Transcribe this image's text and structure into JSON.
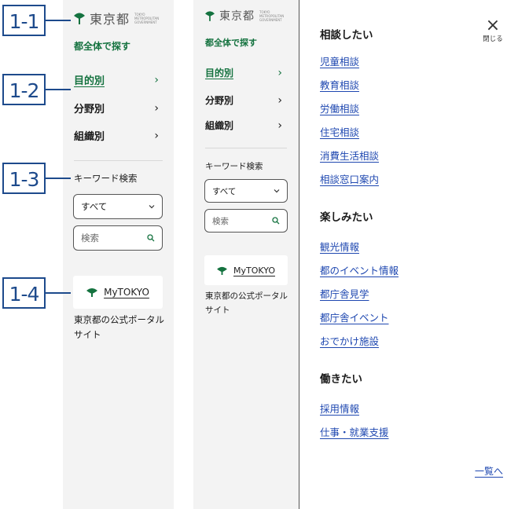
{
  "brand": {
    "name": "東京都",
    "sub": "TOKYO METROPOLITAN GOVERNMENT",
    "color": "#14723f"
  },
  "callouts": [
    "1-1",
    "1-2",
    "1-3",
    "1-4"
  ],
  "sidebar": {
    "section_label": "都全体で探す",
    "nav": [
      {
        "label": "目的別",
        "active": true
      },
      {
        "label": "分野別",
        "active": false
      },
      {
        "label": "組織別",
        "active": false
      }
    ],
    "chevron": "›",
    "keyword_label": "キーワード検索",
    "select_value": "すべて",
    "search_placeholder": "検索",
    "mytokyo": {
      "brand": "MyTOKYO",
      "caption": "東京都の公式ポータルサイト"
    }
  },
  "panel": {
    "close_label": "閉じる",
    "categories": [
      {
        "title": "相談したい",
        "links": [
          "児童相談",
          "教育相談",
          "労働相談",
          "住宅相談",
          "消費生活相談",
          "相談窓口案内"
        ]
      },
      {
        "title": "楽しみたい",
        "links": [
          "観光情報",
          "都のイベント情報",
          "都庁舎見学",
          "都庁舎イベント",
          "おでかけ施設"
        ]
      },
      {
        "title": "働きたい",
        "links": [
          "採用情報",
          "仕事・就業支援"
        ]
      }
    ],
    "more_link": "一覧へ"
  },
  "colors": {
    "link": "#1e47b0",
    "green": "#14723f",
    "callout": "#1d4a8c"
  }
}
